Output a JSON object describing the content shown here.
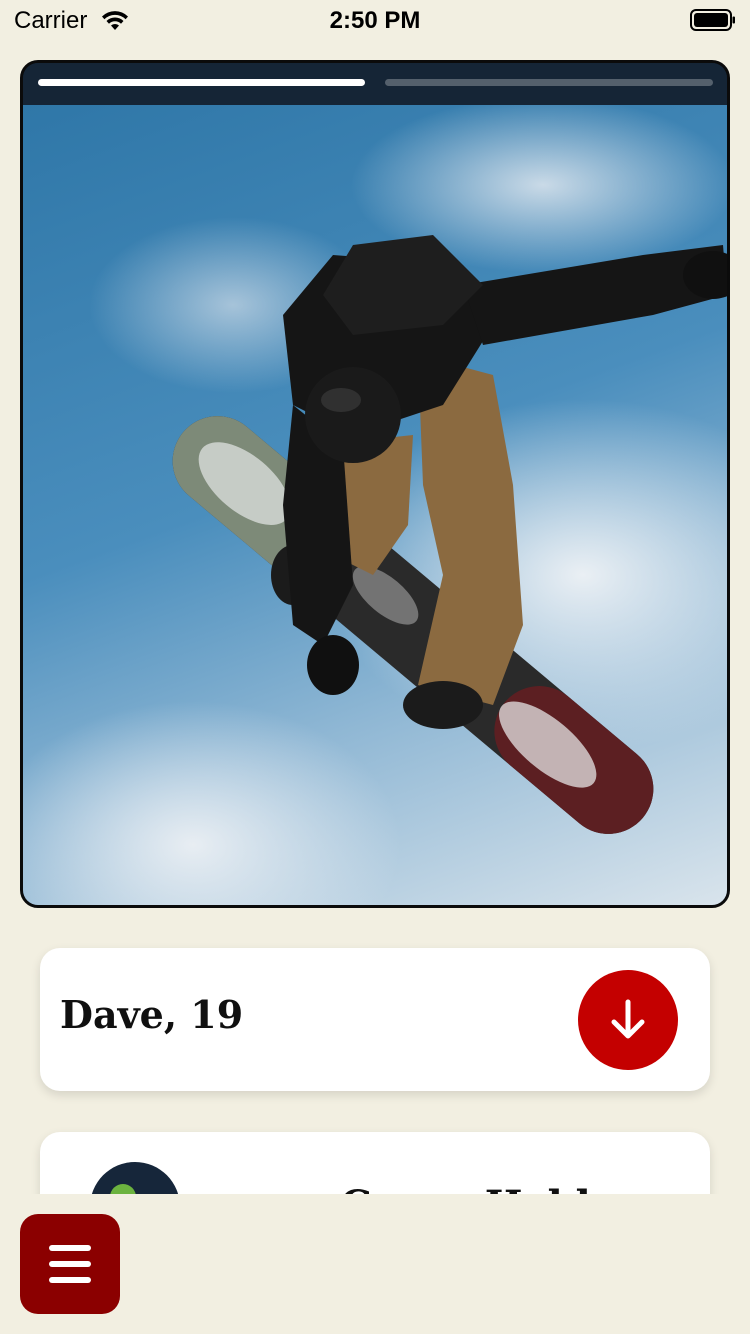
{
  "status_bar": {
    "carrier": "Carrier",
    "time": "2:50 PM",
    "wifi_icon": "wifi-icon",
    "battery_icon": "battery-icon"
  },
  "story": {
    "progress_segments": [
      {
        "state": "active",
        "progress": 1.0
      },
      {
        "state": "upcoming",
        "progress": 0.0
      }
    ],
    "photo_description_icon": "snowboarder-photo"
  },
  "profile": {
    "name_age": "Dave, 19",
    "action_icon": "arrow-down-icon"
  },
  "next_card": {
    "title_partial": "Corgy Hebbs",
    "avatar_icon": "avatar-icon"
  },
  "menu": {
    "icon": "hamburger-icon"
  },
  "colors": {
    "background": "#f2efe1",
    "accent_red": "#c40000",
    "menu_red": "#8b0000",
    "dark_navy": "#152536",
    "card_white": "#ffffff"
  }
}
